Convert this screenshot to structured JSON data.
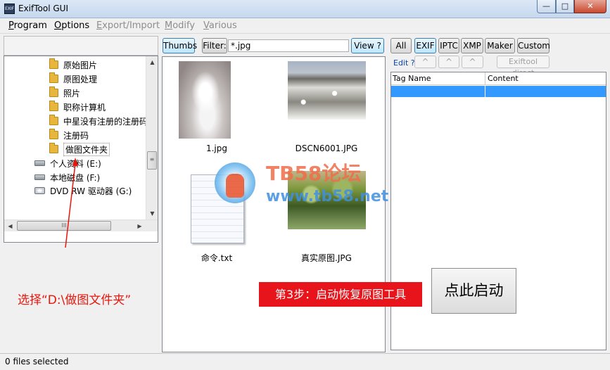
{
  "window": {
    "title": "ExifTool GUI",
    "app_icon_text": "EXIF"
  },
  "menu": {
    "program": "Program",
    "options": "Options",
    "export_import": "Export/Import",
    "modify": "Modify",
    "various": "Various"
  },
  "tree": {
    "items": [
      {
        "label": "原始图片",
        "icon": "folder-icon"
      },
      {
        "label": "原图处理",
        "icon": "folder-icon"
      },
      {
        "label": "照片",
        "icon": "folder-icon"
      },
      {
        "label": "职称计算机",
        "icon": "folder-icon"
      },
      {
        "label": "中星没有注册的注册码",
        "icon": "folder-icon"
      },
      {
        "label": "注册码",
        "icon": "folder-icon"
      },
      {
        "label": "做图文件夹",
        "icon": "folder-icon",
        "selected": true
      },
      {
        "label": "个人资料 (E:)",
        "icon": "drive-icon"
      },
      {
        "label": "本地磁盘 (F:)",
        "icon": "drive-icon"
      },
      {
        "label": "DVD RW 驱动器 (G:)",
        "icon": "dvd-icon"
      }
    ],
    "hscroll_grip": "III",
    "vscroll_grip": "≡"
  },
  "annotations": {
    "select_folder": "选择“D:\\做图文件夹”",
    "step3": "第3步：启动恢复原图工具",
    "start_button": "点此启动"
  },
  "thumbs_toolbar": {
    "thumbs": "Thumbs",
    "filter": "Filter:",
    "filter_value": "*.jpg",
    "view": "View ?"
  },
  "files": [
    {
      "name": "1.jpg"
    },
    {
      "name": "DSCN6001.JPG"
    },
    {
      "name": "命令.txt"
    },
    {
      "name": "真实原图.JPG"
    }
  ],
  "metadata_toolbar": {
    "all": "All",
    "exif": "EXIF",
    "iptc": "IPTC",
    "xmp": "XMP",
    "maker": "Maker",
    "custom": "Custom",
    "edit": "Edit ?",
    "up_arrow": "^",
    "exiftool_direct": "Exiftool direct"
  },
  "grid": {
    "col_tag": "Tag Name",
    "col_content": "Content"
  },
  "watermark": {
    "title": "TB58论坛",
    "url": "www.tb58.net"
  },
  "status": {
    "text": "0 files selected"
  },
  "colors": {
    "annotation_red": "#e8160c",
    "banner_red": "#e8141b",
    "selection_blue": "#3399ff"
  }
}
